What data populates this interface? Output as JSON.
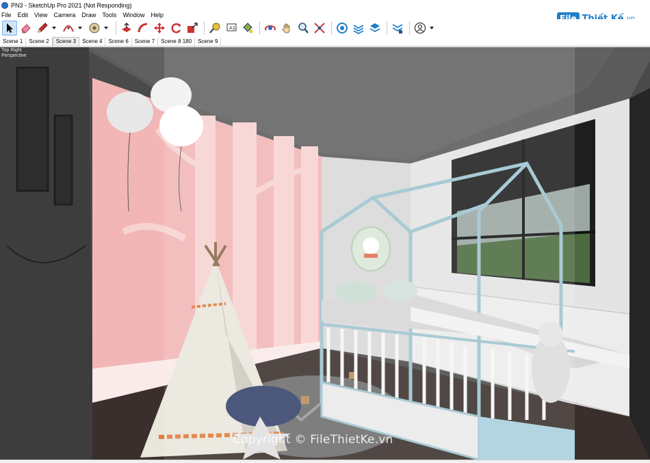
{
  "window": {
    "title": "PN3 - SketchUp Pro 2021 (Not Responding)"
  },
  "menu": {
    "items": [
      "File",
      "Edit",
      "View",
      "Camera",
      "Draw",
      "Tools",
      "Window",
      "Help"
    ]
  },
  "logo": {
    "box": "File",
    "text": "Thiết Kế",
    "suffix": ".vn"
  },
  "scenes": {
    "tabs": [
      "Scene 1",
      "Scene 2",
      "Scene 3",
      "Scene 4",
      "Scene 6",
      "Scene 7",
      "Scene 8 180",
      "Scene 9"
    ],
    "active": "Scene 3"
  },
  "viewport": {
    "view_name": "Top Right",
    "projection": "Perspective",
    "watermark": "Copyright © FileThietKe.vn"
  },
  "colors": {
    "accent": "#1e7fc9",
    "wall_pink": "#f2b6b6",
    "ceiling": "#5a5a5a",
    "bed_frame": "#9ec3cf"
  }
}
